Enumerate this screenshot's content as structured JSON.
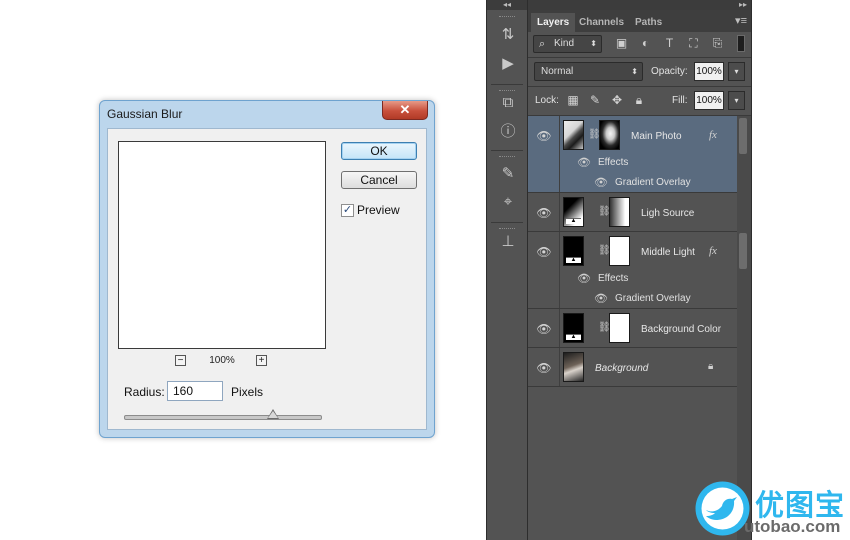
{
  "dialog": {
    "title": "Gaussian Blur",
    "close_glyph": "✕",
    "ok_label": "OK",
    "cancel_label": "Cancel",
    "preview_label": "Preview",
    "preview_checked": true,
    "check_glyph": "✓",
    "zoom_out_glyph": "−",
    "zoom_in_glyph": "+",
    "zoom_level": "100%",
    "radius_label": "Radius:",
    "radius_value": "160",
    "radius_unit": "Pixels",
    "slider_fraction": 0.75
  },
  "panel": {
    "collapse_glyph": "◂◂",
    "expand_glyph": "▸▸",
    "tabs": [
      {
        "label": "Layers",
        "active": true
      },
      {
        "label": "Channels",
        "active": false
      },
      {
        "label": "Paths",
        "active": false
      }
    ],
    "menu_glyph": "▾≡",
    "filter_kind": "Kind",
    "filter_icons": [
      "image-filter-icon",
      "adjustment-filter-icon",
      "type-filter-icon",
      "shape-filter-icon",
      "smart-object-filter-icon"
    ],
    "blend_mode": "Normal",
    "opacity_label": "Opacity:",
    "opacity_value": "100%",
    "lock_label": "Lock:",
    "fill_label": "Fill:",
    "fill_value": "100%",
    "lock_icons": [
      "lock-transparent-icon",
      "lock-pixels-icon",
      "lock-position-icon",
      "lock-all-icon"
    ]
  },
  "layers": [
    {
      "name": "Main Photo",
      "selected": true,
      "fx": true,
      "effects_label": "Effects",
      "effects": [
        "Gradient Overlay"
      ]
    },
    {
      "name": "Ligh Source",
      "selected": false,
      "fx": false,
      "effects": []
    },
    {
      "name": "Middle Light",
      "selected": false,
      "fx": true,
      "effects_label": "Effects",
      "effects": [
        "Gradient Overlay"
      ]
    },
    {
      "name": "Background Color",
      "selected": false,
      "fx": false,
      "effects": []
    },
    {
      "name": "Background",
      "selected": false,
      "fx": false,
      "locked": true,
      "effects": []
    }
  ],
  "fx_symbol": "fx",
  "watermark": {
    "chinese": "优图宝",
    "url": "utobao.com"
  },
  "colors": {
    "panel_bg": "#535353",
    "selected_row": "#5a6b7f",
    "dialog_border": "#6fa3cf",
    "close_button": "#c9503c",
    "watermark_blue": "#2fb7ee"
  }
}
